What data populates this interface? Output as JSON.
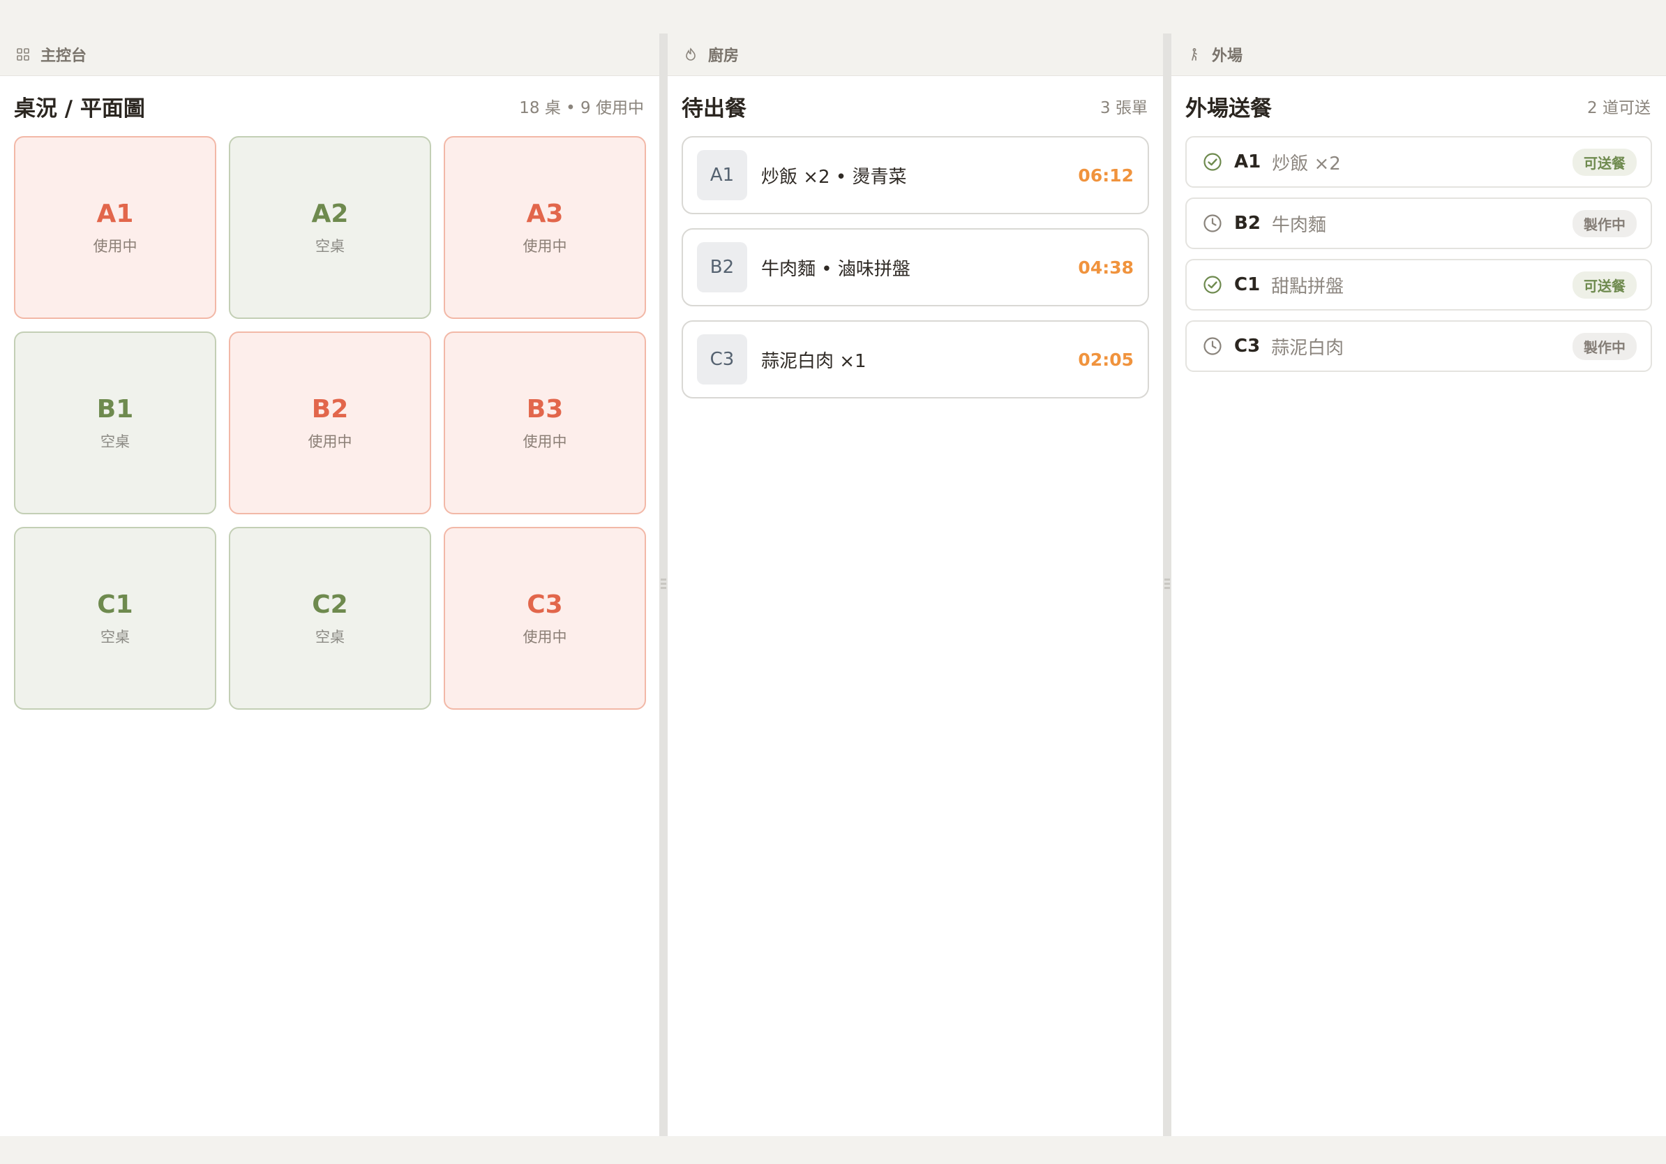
{
  "dashboard": {
    "tab_label": "主控台",
    "title": "桌況 / 平面圖",
    "summary": "18 桌 • 9 使用中",
    "tables": [
      {
        "code": "A1",
        "status": "使用中",
        "state": "busy"
      },
      {
        "code": "A2",
        "status": "空桌",
        "state": "free"
      },
      {
        "code": "A3",
        "status": "使用中",
        "state": "busy"
      },
      {
        "code": "B1",
        "status": "空桌",
        "state": "free"
      },
      {
        "code": "B2",
        "status": "使用中",
        "state": "busy"
      },
      {
        "code": "B3",
        "status": "使用中",
        "state": "busy"
      },
      {
        "code": "C1",
        "status": "空桌",
        "state": "free"
      },
      {
        "code": "C2",
        "status": "空桌",
        "state": "free"
      },
      {
        "code": "C3",
        "status": "使用中",
        "state": "busy"
      }
    ]
  },
  "kitchen": {
    "tab_label": "廚房",
    "title": "待出餐",
    "summary": "3 張單",
    "orders": [
      {
        "table": "A1",
        "items": "炒飯 ×2 • 燙青菜",
        "timer": "06:12"
      },
      {
        "table": "B2",
        "items": "牛肉麵 • 滷味拼盤",
        "timer": "04:38"
      },
      {
        "table": "C3",
        "items": "蒜泥白肉 ×1",
        "timer": "02:05"
      }
    ]
  },
  "floor": {
    "tab_label": "外場",
    "title": "外場送餐",
    "summary": "2 道可送",
    "deliveries": [
      {
        "table": "A1",
        "item": "炒飯 ×2",
        "badge": "可送餐",
        "state": "ready"
      },
      {
        "table": "B2",
        "item": "牛肉麵",
        "badge": "製作中",
        "state": "cooking"
      },
      {
        "table": "C1",
        "item": "甜點拼盤",
        "badge": "可送餐",
        "state": "ready"
      },
      {
        "table": "C3",
        "item": "蒜泥白肉",
        "badge": "製作中",
        "state": "cooking"
      }
    ]
  },
  "colors": {
    "busy": "#e2664b",
    "free": "#6e8a4e",
    "timer": "#f0933d",
    "background": "#f3f2ee"
  },
  "icons": {
    "dashboard_tab": "grid-icon",
    "kitchen_tab": "flame-icon",
    "floor_tab": "person-walking-icon",
    "ready": "check-circle-icon",
    "cooking": "clock-icon"
  }
}
